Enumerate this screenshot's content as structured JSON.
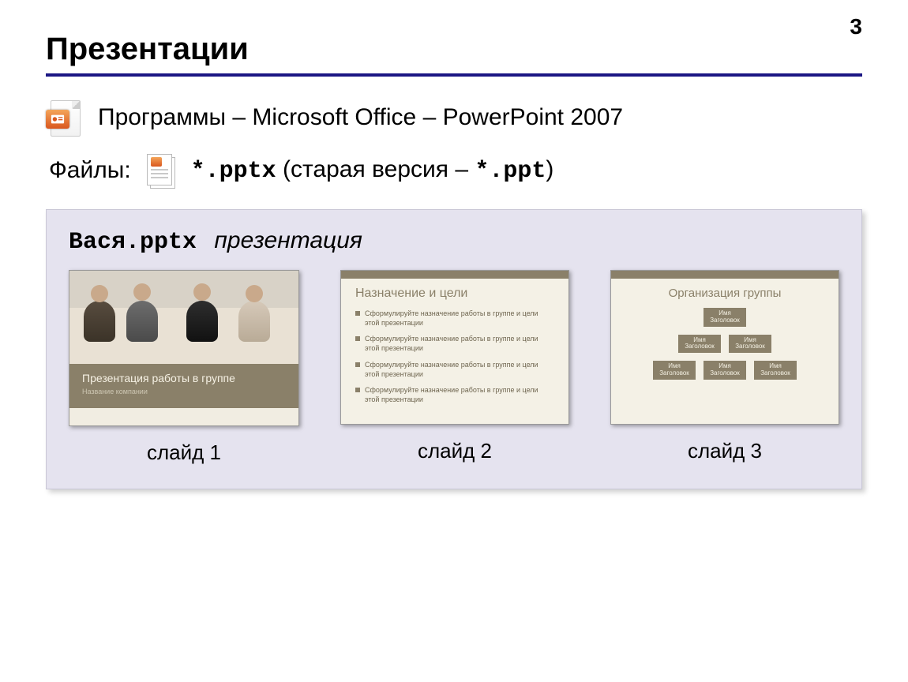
{
  "page_number": "3",
  "title": "Презентации",
  "line1": {
    "text": "Программы – Microsoft Office – PowerPoint 2007"
  },
  "line2": {
    "label": "Файлы:",
    "ext1": "*.pptx",
    "mid": " (старая версия –  ",
    "ext2": "*.ppt",
    "end": ")"
  },
  "panel": {
    "filename": "Вася.pptx",
    "label": "презентация"
  },
  "slide1": {
    "title": "Презентация работы в группе",
    "subtitle": "Название компании",
    "caption": "слайд 1"
  },
  "slide2": {
    "title": "Назначение и цели",
    "bullet": "Сформулируйте назначение работы в группе и цели этой презентации",
    "caption": "слайд 2"
  },
  "slide3": {
    "title": "Организация группы",
    "node_line1": "Имя",
    "node_line2": "Заголовок",
    "caption": "слайд 3"
  }
}
